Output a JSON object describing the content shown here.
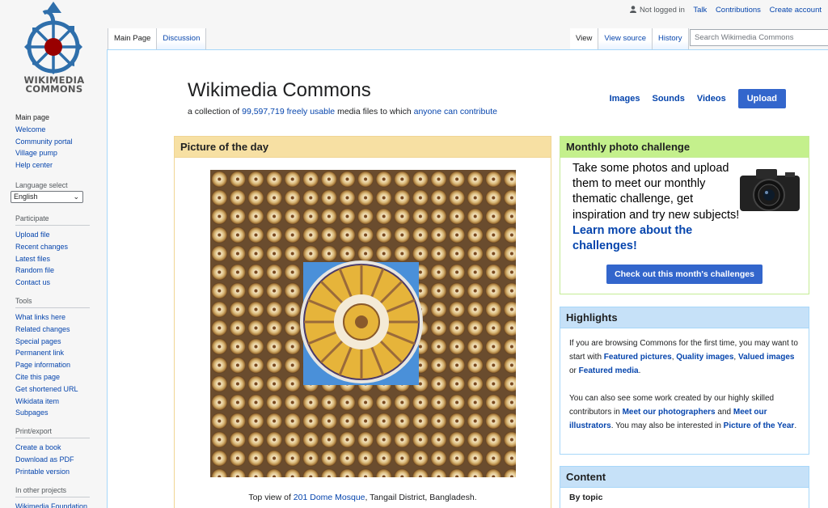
{
  "logo": {
    "line1": "WIKIMEDIA",
    "line2": "COMMONS"
  },
  "personal": {
    "not_logged_in": "Not logged in",
    "talk": "Talk",
    "contributions": "Contributions",
    "create_account": "Create account"
  },
  "tabs": {
    "main_page": "Main Page",
    "discussion": "Discussion",
    "view": "View",
    "view_source": "View source",
    "history": "History"
  },
  "search": {
    "placeholder": "Search Wikimedia Commons"
  },
  "sidebar": {
    "navigation": [
      "Main page",
      "Welcome",
      "Community portal",
      "Village pump",
      "Help center"
    ],
    "language_heading": "Language select",
    "language_value": "English",
    "participate_heading": "Participate",
    "participate": [
      "Upload file",
      "Recent changes",
      "Latest files",
      "Random file",
      "Contact us"
    ],
    "tools_heading": "Tools",
    "tools": [
      "What links here",
      "Related changes",
      "Special pages",
      "Permanent link",
      "Page information",
      "Cite this page",
      "Get shortened URL",
      "Wikidata item",
      "Subpages"
    ],
    "print_heading": "Print/export",
    "print": [
      "Create a book",
      "Download as PDF",
      "Printable version"
    ],
    "other_heading": "In other projects",
    "other": [
      "Wikimedia Foundation"
    ]
  },
  "header": {
    "title": "Wikimedia Commons",
    "subtitle_prefix": "a collection of ",
    "count": "99,597,719",
    "freely_usable": "freely usable",
    "subtitle_mid": " media files to which ",
    "anyone_contribute": "anyone can contribute",
    "images": "Images",
    "sounds": "Sounds",
    "videos": "Videos",
    "upload": "Upload"
  },
  "potd": {
    "heading": "Picture of the day",
    "caption_prefix": "Top view of ",
    "caption_link": "201 Dome Mosque",
    "caption_suffix": ", Tangail District, Bangladesh."
  },
  "challenge": {
    "heading": "Monthly photo challenge",
    "text": "Take some photos and upload them to meet our monthly thematic challenge, get inspiration and try new subjects! ",
    "link": "Learn more about the challenges!",
    "button": "Check out this month's challenges"
  },
  "highlights": {
    "heading": "Highlights",
    "p1_a": "If you are browsing Commons for the first time, you may want to start with ",
    "featured_pictures": "Featured pictures",
    "comma": ", ",
    "quality_images": "Quality images",
    "comma2": ",",
    "valued_images": "Valued images",
    "or": " or ",
    "featured_media": "Featured media",
    "period": ".",
    "p2_a": "You can also see some work created by our highly skilled contributors in ",
    "meet_photographers": "Meet our photographers",
    "and": " and ",
    "meet_illustrators": "Meet our illustrators",
    "p2_b": ". You may also be interested in ",
    "picture_of_year": "Picture of the Year",
    "period2": "."
  },
  "content": {
    "heading": "Content",
    "by_topic": "By topic"
  },
  "colors": {
    "link": "#0645ad",
    "button": "#3366cc",
    "potd_head": "#f7e0a3",
    "challenge_head": "#c4f08c",
    "highlights_head": "#c6e1f8"
  }
}
